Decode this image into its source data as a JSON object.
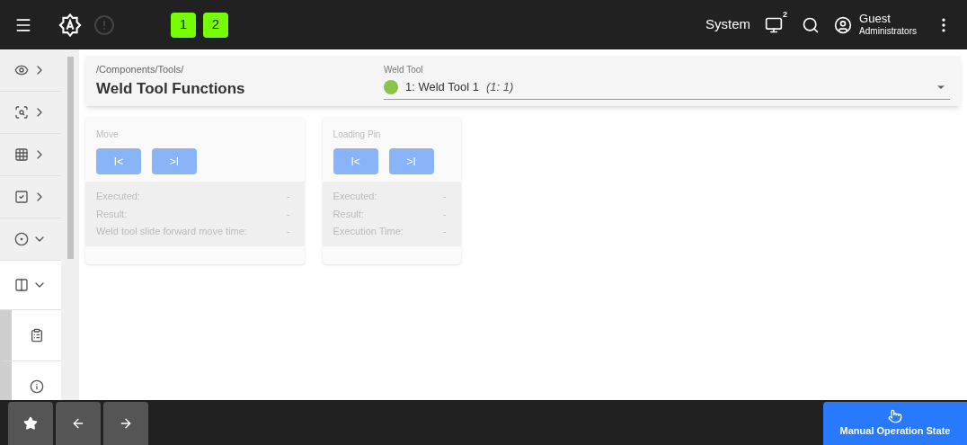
{
  "top_bar": {
    "workspaces": [
      {
        "label": "1",
        "selected": true
      },
      {
        "label": "2",
        "selected": true
      }
    ],
    "system_label": "System",
    "screen_count": "2",
    "user": {
      "name": "Guest",
      "group": "Administrators"
    }
  },
  "sidebar": {
    "items": [
      {
        "expanded": false,
        "selected": false
      },
      {
        "expanded": false,
        "selected": false
      },
      {
        "expanded": false,
        "selected": false
      },
      {
        "expanded": false,
        "selected": false
      },
      {
        "expanded": true,
        "selected": false
      },
      {
        "expanded": true,
        "selected": true,
        "children": [
          {
            "selected": false
          },
          {
            "selected": false
          }
        ]
      }
    ]
  },
  "header": {
    "breadcrumb": "/Components/Tools/",
    "title": "Weld Tool Functions",
    "selector": {
      "label": "Weld Tool",
      "value": "1: Weld Tool 1",
      "detail": "(1: 1)",
      "online": true
    }
  },
  "cards": [
    {
      "title": "Move",
      "disabled": true,
      "buttons": [
        "I<",
        ">I"
      ],
      "rows": [
        {
          "label": "Executed:",
          "value": "-"
        },
        {
          "label": "Result:",
          "value": "-"
        },
        {
          "label": "Weld tool slide forward move time:",
          "value": "-"
        }
      ]
    },
    {
      "title": "Loading Pin",
      "disabled": true,
      "buttons": [
        "I<",
        ">I"
      ],
      "rows": [
        {
          "label": "Executed:",
          "value": "-"
        },
        {
          "label": "Result:",
          "value": "-"
        },
        {
          "label": "Execution Time:",
          "value": "-"
        }
      ]
    }
  ],
  "bottom_bar": {
    "action": "Manual Operation State"
  }
}
